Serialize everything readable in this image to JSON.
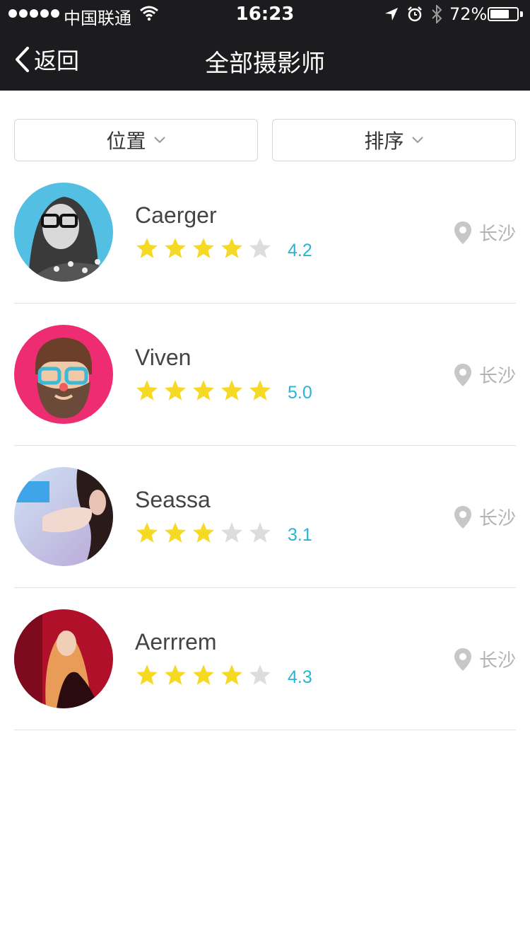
{
  "status_bar": {
    "carrier": "中国联通",
    "time": "16:23",
    "battery": "72%",
    "battery_level": 0.72
  },
  "nav": {
    "back_label": "返回",
    "title": "全部摄影师"
  },
  "filters": {
    "location_label": "位置",
    "sort_label": "排序"
  },
  "colors": {
    "star_filled": "#f5d923",
    "star_empty": "#dddddd",
    "score": "#2ab4d4",
    "location": "#b3b3b3"
  },
  "photographers": [
    {
      "name": "Caerger",
      "rating": "4.2",
      "stars_filled": 4,
      "city": "长沙",
      "avatar_icon": "photo-avatar-woman-glasses"
    },
    {
      "name": "Viven",
      "rating": "5.0",
      "stars_filled": 5,
      "city": "长沙",
      "avatar_icon": "cartoon-avatar-bearded-man"
    },
    {
      "name": "Seassa",
      "rating": "3.1",
      "stars_filled": 3,
      "city": "长沙",
      "avatar_icon": "photo-avatar-woman-wall"
    },
    {
      "name": "Aerrrem",
      "rating": "4.3",
      "stars_filled": 4,
      "city": "长沙",
      "avatar_icon": "photo-avatar-woman-red"
    }
  ]
}
